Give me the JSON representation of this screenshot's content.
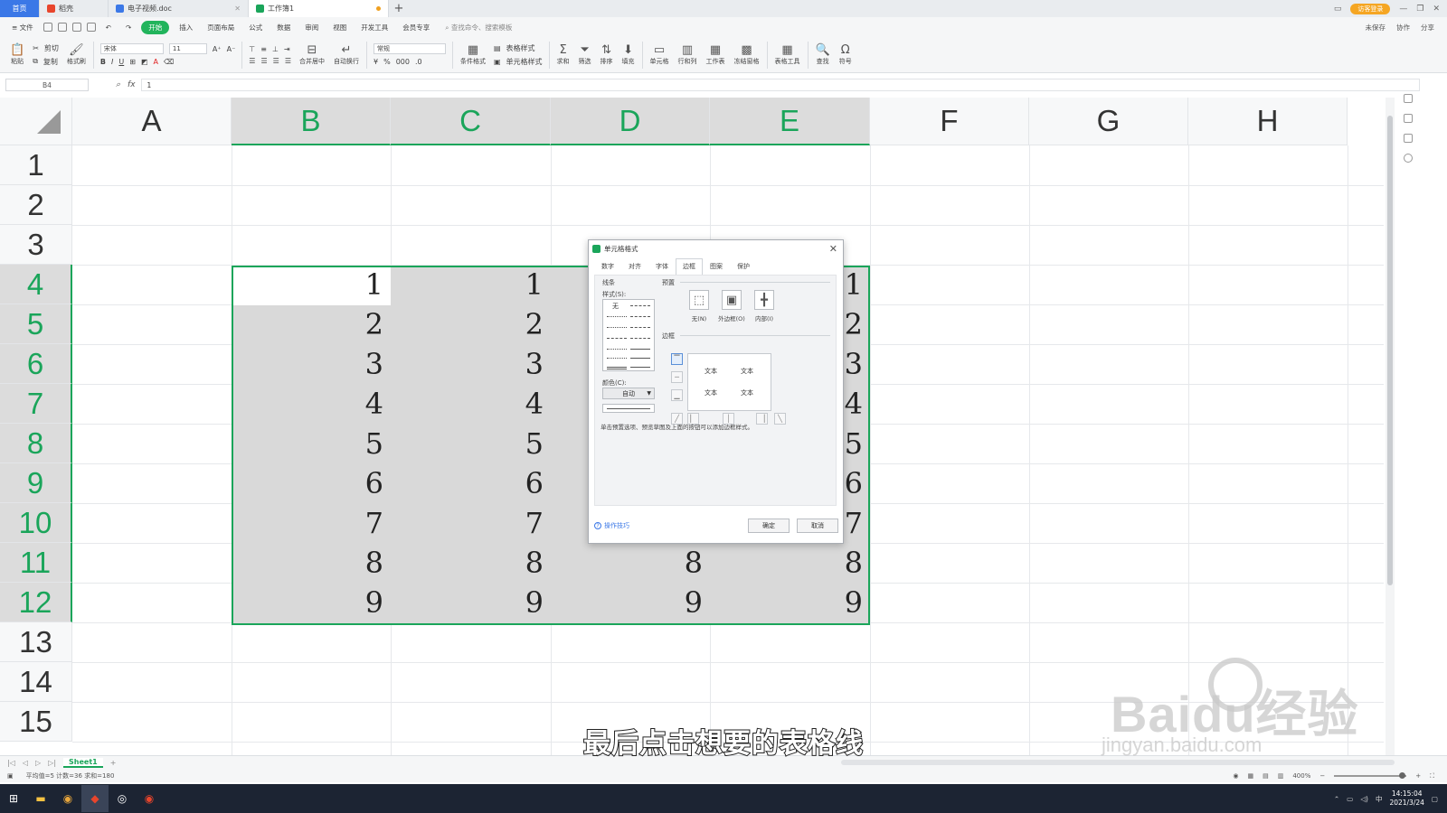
{
  "titlebar": {
    "tabs": [
      {
        "label": "首页",
        "kind": "home"
      },
      {
        "label": "稻壳",
        "kind": "docer"
      },
      {
        "label": "电子视频.doc",
        "kind": "doc"
      },
      {
        "label": "工作簿1",
        "kind": "sheet",
        "active": true
      }
    ],
    "new_tab": "+",
    "login": "访客登录"
  },
  "menubar": {
    "file": "文件",
    "items": [
      "开始",
      "插入",
      "页面布局",
      "公式",
      "数据",
      "审阅",
      "视图",
      "开发工具",
      "会员专享"
    ],
    "search": "查找命令、搜索模板",
    "right": [
      "未保存",
      "协作",
      "分享"
    ]
  },
  "ribbon": {
    "paste": "粘贴",
    "cut": "剪切",
    "copy": "复制",
    "format_painter": "格式刷",
    "font_name": "宋体",
    "font_size": "11",
    "number_format": "常规",
    "merge": "合并居中",
    "wrap": "自动换行",
    "cond_format": "条件格式",
    "table_style": "表格样式",
    "cell_style": "单元格样式",
    "sum": "求和",
    "filter": "筛选",
    "sort": "排序",
    "fill": "填充",
    "cell": "单元格",
    "rowcol": "行和列",
    "worksheet": "工作表",
    "freeze": "冻结窗格",
    "table_tools": "表格工具",
    "find": "查找",
    "symbol": "符号"
  },
  "formulabar": {
    "namebox": "B4",
    "fx": "fx",
    "value": "1"
  },
  "grid": {
    "columns": [
      "A",
      "B",
      "C",
      "D",
      "E",
      "F",
      "G",
      "H"
    ],
    "selected_columns": [
      "B",
      "C",
      "D",
      "E"
    ],
    "rows": [
      "1",
      "2",
      "3",
      "4",
      "5",
      "6",
      "7",
      "8",
      "9",
      "10",
      "11",
      "12",
      "13",
      "14",
      "15"
    ],
    "selected_rows": [
      "4",
      "5",
      "6",
      "7",
      "8",
      "9",
      "10",
      "11",
      "12"
    ],
    "cells": {
      "B": [
        "1",
        "2",
        "3",
        "4",
        "5",
        "6",
        "7",
        "8",
        "9"
      ],
      "C": [
        "1",
        "2",
        "3",
        "4",
        "5",
        "6",
        "7",
        "8",
        "9"
      ],
      "D": [
        "",
        "",
        "",
        "",
        "",
        "",
        "7",
        "8",
        "9"
      ],
      "E": [
        "1",
        "2",
        "3",
        "4",
        "5",
        "6",
        "7",
        "8",
        "9"
      ]
    }
  },
  "dialog": {
    "title": "单元格格式",
    "tabs": [
      "数字",
      "对齐",
      "字体",
      "边框",
      "图案",
      "保护"
    ],
    "active_tab": "边框",
    "line_group": "线条",
    "style_label": "样式(S):",
    "style_none": "无",
    "color_label": "颜色(C):",
    "color_value": "自动",
    "preset_group": "预置",
    "presets": [
      "无(N)",
      "外边框(O)",
      "内部(I)"
    ],
    "border_group": "边框",
    "preview_text": [
      "文本",
      "文本",
      "文本",
      "文本"
    ],
    "hint": "单击预置选项、预览草图及上面的按钮可以添加边框样式。",
    "tips": "操作技巧",
    "ok": "确定",
    "cancel": "取消"
  },
  "sheetbar": {
    "sheet": "Sheet1",
    "add": "+"
  },
  "statusbar": {
    "stats": "平均值=5  计数=36  求和=180",
    "zoom": "400%"
  },
  "taskbar": {
    "time": "14:15:04",
    "date": "2021/3/24"
  },
  "overlay": {
    "subtitle": "最后点击想要的表格线",
    "watermark_main": "Baidu经验",
    "watermark_url": "jingyan.baidu.com"
  },
  "colors": {
    "accent_green": "#1aa55a",
    "selection_gray": "#d9d9d9",
    "home_blue": "#3b78e7"
  }
}
